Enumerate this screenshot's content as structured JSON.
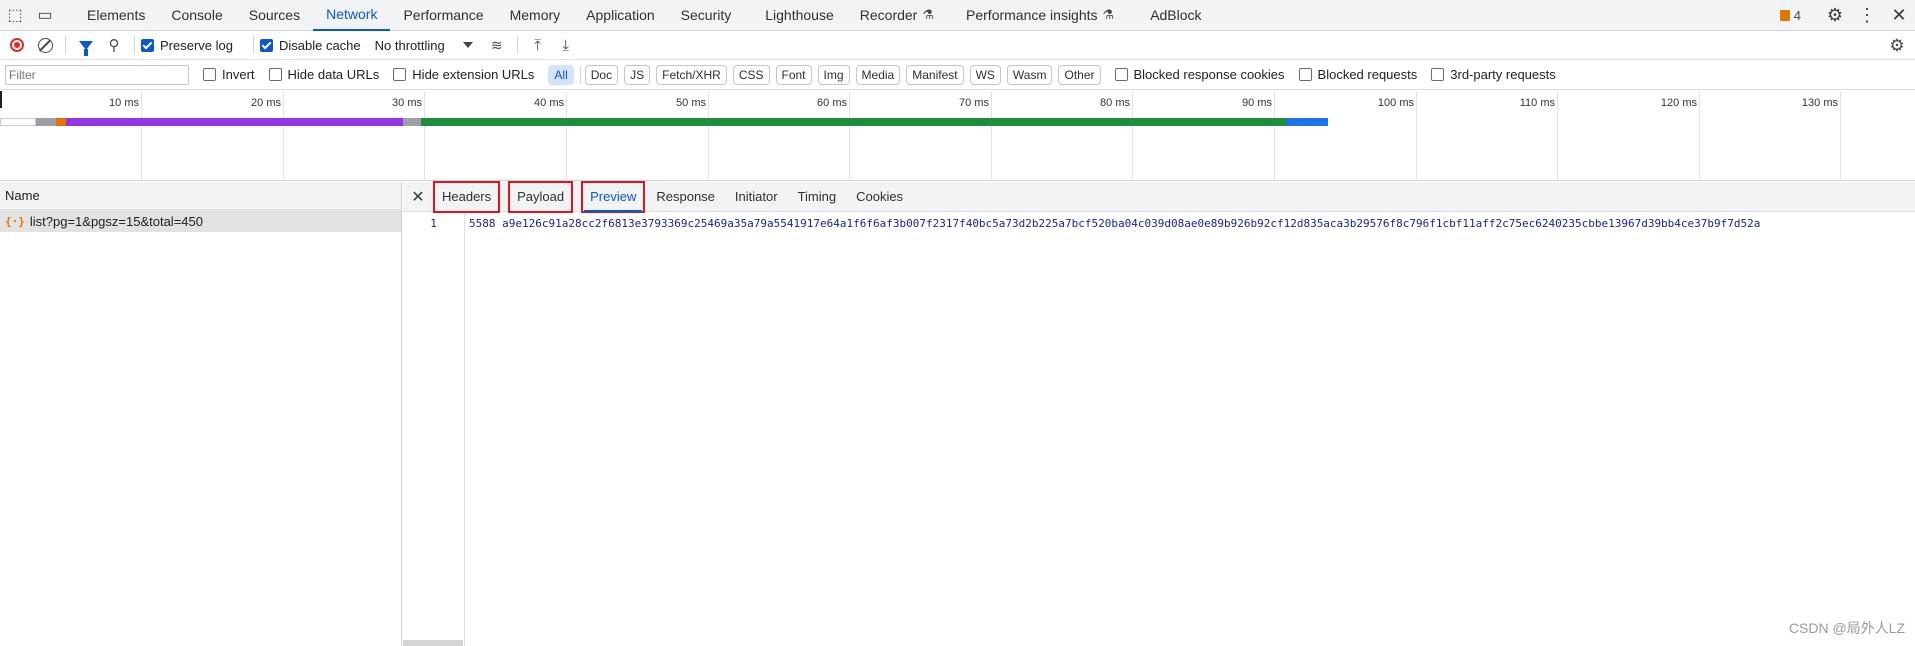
{
  "top_tabs": [
    "Elements",
    "Console",
    "Sources",
    "Network",
    "Performance",
    "Memory",
    "Application",
    "Security",
    "Lighthouse",
    "Recorder",
    "Performance insights",
    "AdBlock"
  ],
  "active_top_tab": "Network",
  "issues_count": "4",
  "toolbar": {
    "preserve_log": "Preserve log",
    "disable_cache": "Disable cache",
    "throttling": "No throttling"
  },
  "filter": {
    "placeholder": "Filter",
    "invert": "Invert",
    "hide_data_urls": "Hide data URLs",
    "hide_extension_urls": "Hide extension URLs",
    "types": [
      "All",
      "Doc",
      "JS",
      "Fetch/XHR",
      "CSS",
      "Font",
      "Img",
      "Media",
      "Manifest",
      "WS",
      "Wasm",
      "Other"
    ],
    "active_type": "All",
    "blocked_response_cookies": "Blocked response cookies",
    "blocked_requests": "Blocked requests",
    "third_party": "3rd-party requests"
  },
  "timeline": {
    "ticks": [
      "10 ms",
      "20 ms",
      "30 ms",
      "40 ms",
      "50 ms",
      "60 ms",
      "70 ms",
      "80 ms",
      "90 ms",
      "100 ms",
      "110 ms",
      "120 ms",
      "130 ms"
    ]
  },
  "request_list": {
    "header": "Name",
    "rows": [
      "list?pg=1&pgsz=15&total=450"
    ]
  },
  "details": {
    "tabs": [
      "Headers",
      "Payload",
      "Preview",
      "Response",
      "Initiator",
      "Timing",
      "Cookies"
    ],
    "active_tab": "Preview",
    "highlighted_tabs": [
      "Headers",
      "Payload",
      "Preview"
    ],
    "preview": {
      "line_number": "1",
      "content": "5588 a9e126c91a28cc2f6813e3793369c25469a35a79a5541917e64a1f6f6af3b007f2317f40bc5a73d2b225a7bcf520ba04c039d08ae0e89b926b92cf12d835aca3b29576f8c796f1cbf11aff2c75ec6240235cbbe13967d39bb4ce37b9f7d52a"
    }
  },
  "watermark": "CSDN @局外人LZ"
}
